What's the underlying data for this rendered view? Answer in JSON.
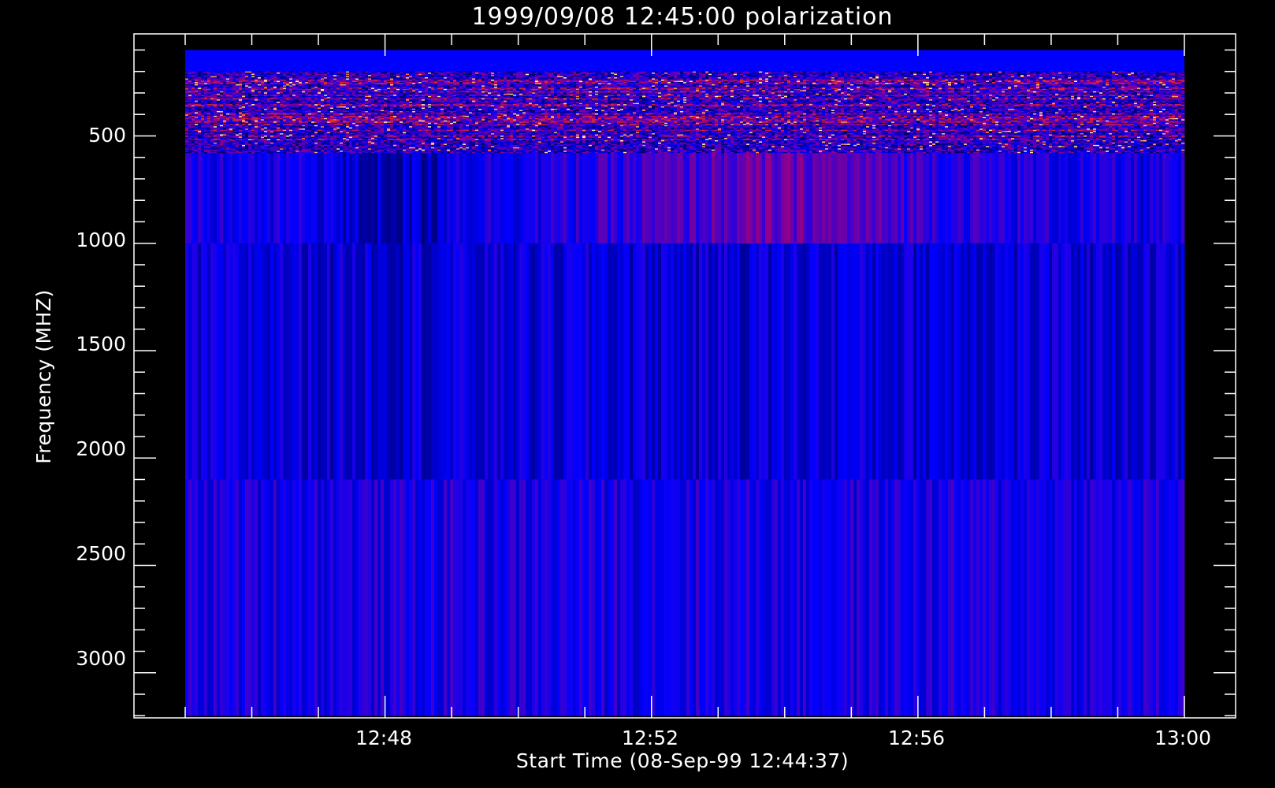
{
  "chart_data": {
    "type": "heatmap",
    "title": "1999/09/08 12:45:00 polarization",
    "xlabel": "Start Time (08-Sep-99 12:44:37)",
    "ylabel": "Frequency (MHZ)",
    "x_ticks": [
      "12:48",
      "12:52",
      "12:56",
      "13:00"
    ],
    "y_ticks": [
      "500",
      "1000",
      "1500",
      "2000",
      "2500",
      "3000"
    ],
    "y_tick_values": [
      500,
      1000,
      1500,
      2000,
      2500,
      3000
    ],
    "ylim": [
      3210,
      25
    ],
    "x_start": "12:45:00",
    "x_end": "13:00:00",
    "y_inverted": true,
    "colormap": [
      "#000060",
      "#0000ff",
      "#c00020",
      "#ff4000",
      "#ffff80"
    ],
    "bands": [
      {
        "freq_range": [
          100,
          580
        ],
        "description_level": "noisy",
        "mean": 0.35
      },
      {
        "freq_range": [
          580,
          1000
        ],
        "mean": 0.35
      },
      {
        "freq_range": [
          1000,
          2100
        ],
        "mean": 0.22
      },
      {
        "freq_range": [
          2100,
          3200
        ],
        "mean": 0.28
      }
    ],
    "colors": {
      "background": "#000000",
      "axes": "#ffffff",
      "base": "#0000ff",
      "accent": "#c00020"
    }
  }
}
